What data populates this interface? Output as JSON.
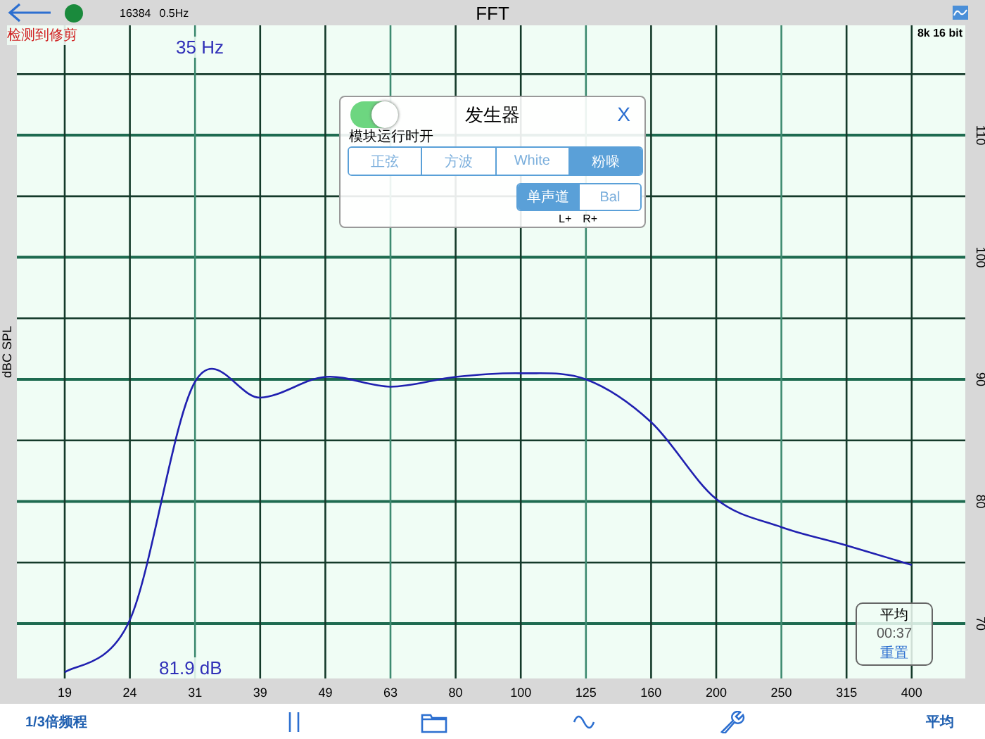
{
  "top_bar": {
    "status_connected": true,
    "fft_size": "16384",
    "resolution": "0.5Hz",
    "title": "FFT",
    "warning": "检测到修剪"
  },
  "plot": {
    "cursor_frequency": "35 Hz",
    "cursor_level": "81.9 dB",
    "format": "8k 16 bit",
    "chart_data": {
      "type": "line",
      "grid": true,
      "ylabel": "dBC SPL",
      "categories": [
        "19",
        "24",
        "31",
        "39",
        "49",
        "63",
        "80",
        "100",
        "125",
        "160",
        "200",
        "250",
        "315",
        "400"
      ],
      "yticks": [
        70,
        80,
        90,
        100,
        110
      ],
      "ylim": [
        65.5,
        119
      ],
      "series": [
        {
          "color": "#2020b0",
          "values": [
            66,
            70.3,
            89.8,
            88.5,
            90.2,
            89.4,
            90.2,
            90.5,
            90,
            86.5,
            80.2,
            77.9,
            76.4,
            74.8
          ]
        }
      ]
    }
  },
  "generator": {
    "title": "发生器",
    "close": "X",
    "enabled": true,
    "enabled_label": "模块运行时开",
    "signals": [
      {
        "label": "正弦",
        "selected": false
      },
      {
        "label": "方波",
        "selected": false
      },
      {
        "label": "White",
        "selected": false
      },
      {
        "label": "粉噪",
        "selected": true
      }
    ],
    "channels": [
      {
        "label": "单声道",
        "selected": true
      },
      {
        "label": "Bal",
        "selected": false
      }
    ],
    "polarity": [
      "L+",
      "R+"
    ]
  },
  "average": {
    "title": "平均",
    "time": "00:37",
    "reset": "重置"
  },
  "toolbar": {
    "left": "1/3倍频程",
    "right": "平均"
  }
}
